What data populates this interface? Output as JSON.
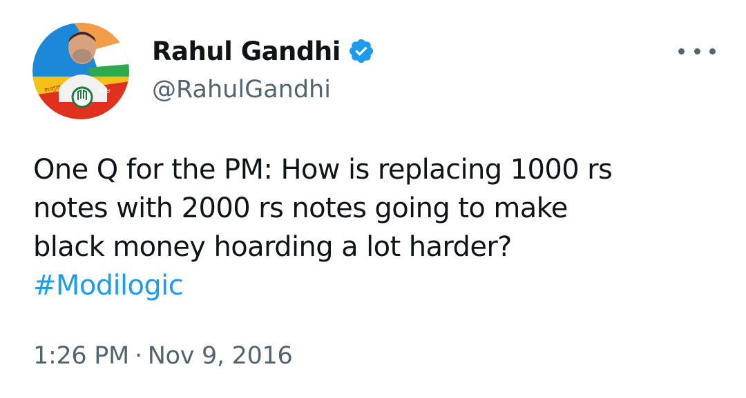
{
  "author": {
    "display_name": "Rahul Gandhi",
    "handle": "@RahulGandhi",
    "verified": true,
    "avatar_icon": "profile-photo-avatar"
  },
  "menu": {
    "icon": "more-options-icon"
  },
  "tweet": {
    "text": "One Q for the PM: How is replacing 1000 rs\nnotes with 2000 rs notes going to make\nblack money hoarding a lot harder?",
    "hashtag": "#Modilogic"
  },
  "meta": {
    "time": "1:26 PM",
    "separator": "·",
    "date": "Nov 9, 2016"
  },
  "colors": {
    "text": "#0f1419",
    "secondary": "#536471",
    "link": "#1d9bf0",
    "verified_badge": "#1d9bf0"
  }
}
